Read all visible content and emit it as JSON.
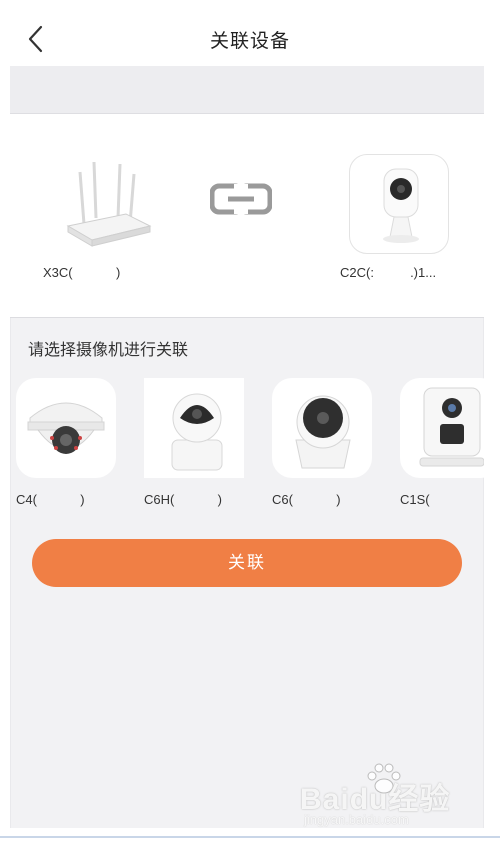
{
  "header": {
    "title": "关联设备",
    "back_icon": "chevron-left-icon"
  },
  "linked": {
    "router_name": "X3C(            )",
    "camera_name": "C2C(:          .)1...",
    "link_icon": "link-icon"
  },
  "select_prompt": "请选择摄像机进行关联",
  "cameras": [
    {
      "label": "C4(            )"
    },
    {
      "label": "C6H(            )"
    },
    {
      "label": "C6(            )"
    },
    {
      "label": "C1S("
    }
  ],
  "action": {
    "associate_label": "关联"
  },
  "watermark": {
    "brand": "Bai",
    "brand_tail": "du",
    "suffix": "经验",
    "url": "jingyan.baidu.com"
  },
  "colors": {
    "accent": "#f07f45",
    "background": "#f2f2f4"
  }
}
